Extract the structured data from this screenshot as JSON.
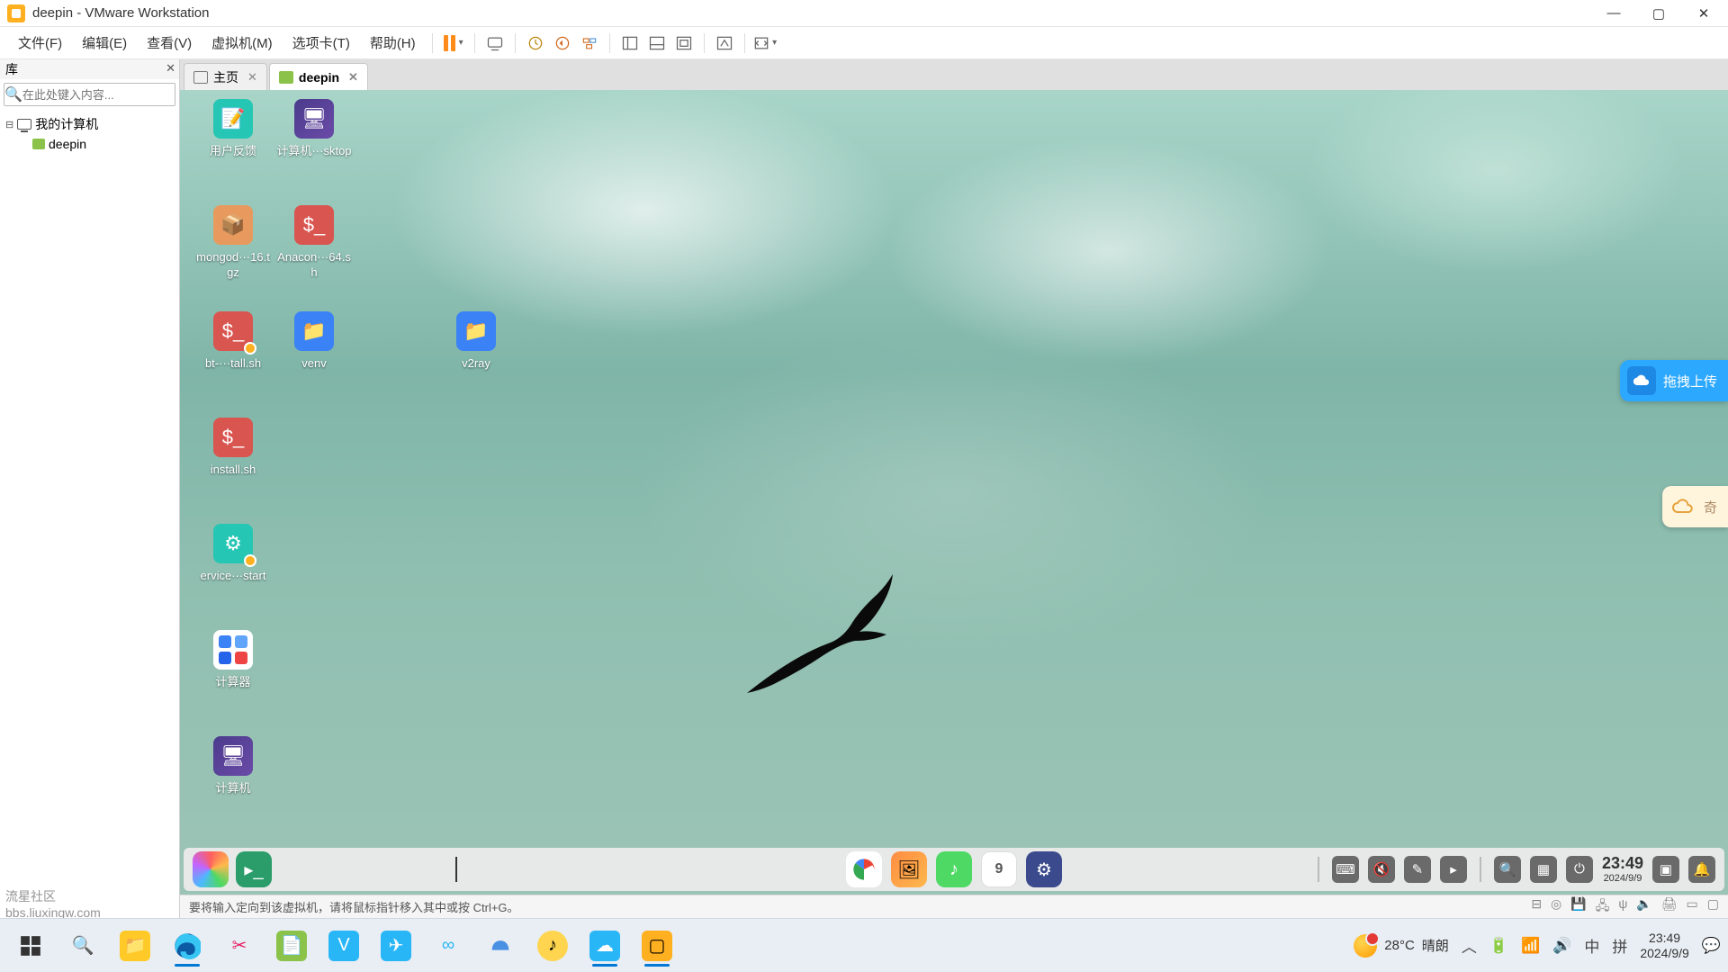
{
  "titlebar": {
    "title": "deepin - VMware Workstation"
  },
  "menu": {
    "file": "文件(F)",
    "edit": "编辑(E)",
    "view": "查看(V)",
    "vm": "虚拟机(M)",
    "tabs": "选项卡(T)",
    "help": "帮助(H)"
  },
  "library": {
    "header": "库",
    "search_placeholder": "在此处键入内容...",
    "root": "我的计算机",
    "vm": "deepin"
  },
  "tabs": {
    "home": "主页",
    "vm": "deepin"
  },
  "desktop_icons": [
    {
      "name": "feedback",
      "label": "用户反馈",
      "style": "teal"
    },
    {
      "name": "computer-desktop",
      "label": "计算机···sktop",
      "style": "purple"
    },
    {
      "name": "mongod",
      "label": "mongod···16.tgz",
      "style": "orange"
    },
    {
      "name": "anaconda",
      "label": "Anacon···64.sh",
      "style": "red"
    },
    {
      "name": "bt-install",
      "label": "bt-···tall.sh",
      "style": "red",
      "dot": true
    },
    {
      "name": "venv",
      "label": "venv",
      "style": "blue"
    },
    {
      "name": "v2ray",
      "label": "v2ray",
      "style": "blue",
      "col": 4
    },
    {
      "name": "install-sh",
      "label": "install.sh",
      "style": "red"
    },
    {
      "name": "service-start",
      "label": "ervice···start",
      "style": "teal",
      "dot": true
    },
    {
      "name": "calculator",
      "label": "计算器",
      "style": "calc"
    },
    {
      "name": "computer",
      "label": "计算机",
      "style": "purple"
    }
  ],
  "side_badges": {
    "upload": "拖拽上传",
    "cloud": "奇"
  },
  "deepin_dock": {
    "calendar_day": "9",
    "time": "23:49",
    "date": "2024/9/9"
  },
  "statusbar": {
    "message": "要将输入定向到该虚拟机，请将鼠标指针移入其中或按 Ctrl+G。"
  },
  "win_taskbar": {
    "weather_temp": "28°C",
    "weather_desc": "晴朗",
    "ime1": "中",
    "ime2": "拼",
    "time": "23:49",
    "date": "2024/9/9"
  },
  "watermark": {
    "line1": "流星社区",
    "line2": "bbs.liuxingw.com"
  }
}
